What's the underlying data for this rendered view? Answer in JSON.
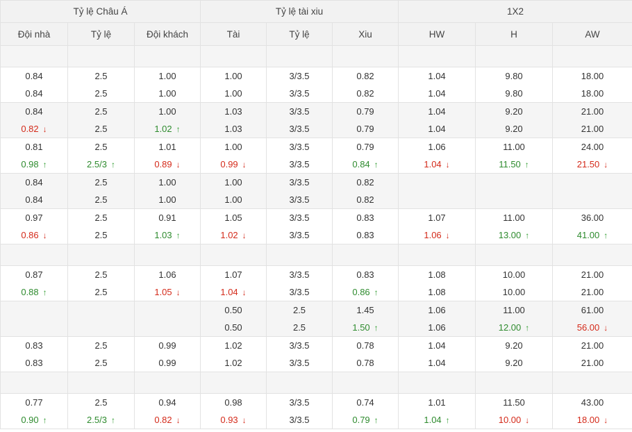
{
  "header": {
    "groups": [
      {
        "label": "Tỷ lệ Châu Á",
        "span": 3
      },
      {
        "label": "Tỷ lệ tài xiu",
        "span": 3
      },
      {
        "label": "1X2",
        "span": 3
      }
    ],
    "columns": [
      "Đội nhà",
      "Tỷ lệ",
      "Đội khách",
      "Tài",
      "Tỷ lệ",
      "Xiu",
      "HW",
      "H",
      "AW"
    ]
  },
  "rows": [
    {
      "empty": true,
      "shade": true
    },
    {
      "shade": false,
      "cells": [
        [
          {
            "v": "0.84"
          },
          {
            "v": "0.84"
          }
        ],
        [
          {
            "v": "2.5"
          },
          {
            "v": "2.5"
          }
        ],
        [
          {
            "v": "1.00"
          },
          {
            "v": "1.00"
          }
        ],
        [
          {
            "v": "1.00"
          },
          {
            "v": "1.00"
          }
        ],
        [
          {
            "v": "3/3.5"
          },
          {
            "v": "3/3.5"
          }
        ],
        [
          {
            "v": "0.82"
          },
          {
            "v": "0.82"
          }
        ],
        [
          {
            "v": "1.04"
          },
          {
            "v": "1.04"
          }
        ],
        [
          {
            "v": "9.80"
          },
          {
            "v": "9.80"
          }
        ],
        [
          {
            "v": "18.00"
          },
          {
            "v": "18.00"
          }
        ]
      ]
    },
    {
      "shade": true,
      "cells": [
        [
          {
            "v": "0.84"
          },
          {
            "v": "0.82",
            "t": "down"
          }
        ],
        [
          {
            "v": "2.5"
          },
          {
            "v": "2.5"
          }
        ],
        [
          {
            "v": "1.00"
          },
          {
            "v": "1.02",
            "t": "up"
          }
        ],
        [
          {
            "v": "1.03"
          },
          {
            "v": "1.03"
          }
        ],
        [
          {
            "v": "3/3.5"
          },
          {
            "v": "3/3.5"
          }
        ],
        [
          {
            "v": "0.79"
          },
          {
            "v": "0.79"
          }
        ],
        [
          {
            "v": "1.04"
          },
          {
            "v": "1.04"
          }
        ],
        [
          {
            "v": "9.20"
          },
          {
            "v": "9.20"
          }
        ],
        [
          {
            "v": "21.00"
          },
          {
            "v": "21.00"
          }
        ]
      ]
    },
    {
      "shade": false,
      "cells": [
        [
          {
            "v": "0.81"
          },
          {
            "v": "0.98",
            "t": "up"
          }
        ],
        [
          {
            "v": "2.5"
          },
          {
            "v": "2.5/3",
            "t": "up"
          }
        ],
        [
          {
            "v": "1.01"
          },
          {
            "v": "0.89",
            "t": "down"
          }
        ],
        [
          {
            "v": "1.00"
          },
          {
            "v": "0.99",
            "t": "down"
          }
        ],
        [
          {
            "v": "3/3.5"
          },
          {
            "v": "3/3.5"
          }
        ],
        [
          {
            "v": "0.79"
          },
          {
            "v": "0.84",
            "t": "up"
          }
        ],
        [
          {
            "v": "1.06"
          },
          {
            "v": "1.04",
            "t": "down"
          }
        ],
        [
          {
            "v": "11.00"
          },
          {
            "v": "11.50",
            "t": "up"
          }
        ],
        [
          {
            "v": "24.00"
          },
          {
            "v": "21.50",
            "t": "down"
          }
        ]
      ]
    },
    {
      "shade": true,
      "cells": [
        [
          {
            "v": "0.84"
          },
          {
            "v": "0.84"
          }
        ],
        [
          {
            "v": "2.5"
          },
          {
            "v": "2.5"
          }
        ],
        [
          {
            "v": "1.00"
          },
          {
            "v": "1.00"
          }
        ],
        [
          {
            "v": "1.00"
          },
          {
            "v": "1.00"
          }
        ],
        [
          {
            "v": "3/3.5"
          },
          {
            "v": "3/3.5"
          }
        ],
        [
          {
            "v": "0.82"
          },
          {
            "v": "0.82"
          }
        ],
        [],
        [],
        []
      ]
    },
    {
      "shade": false,
      "cells": [
        [
          {
            "v": "0.97"
          },
          {
            "v": "0.86",
            "t": "down"
          }
        ],
        [
          {
            "v": "2.5"
          },
          {
            "v": "2.5"
          }
        ],
        [
          {
            "v": "0.91"
          },
          {
            "v": "1.03",
            "t": "up"
          }
        ],
        [
          {
            "v": "1.05"
          },
          {
            "v": "1.02",
            "t": "down"
          }
        ],
        [
          {
            "v": "3/3.5"
          },
          {
            "v": "3/3.5"
          }
        ],
        [
          {
            "v": "0.83"
          },
          {
            "v": "0.83"
          }
        ],
        [
          {
            "v": "1.07"
          },
          {
            "v": "1.06",
            "t": "down"
          }
        ],
        [
          {
            "v": "11.00"
          },
          {
            "v": "13.00",
            "t": "up"
          }
        ],
        [
          {
            "v": "36.00"
          },
          {
            "v": "41.00",
            "t": "up"
          }
        ]
      ]
    },
    {
      "empty": true,
      "shade": true
    },
    {
      "shade": false,
      "cells": [
        [
          {
            "v": "0.87"
          },
          {
            "v": "0.88",
            "t": "up"
          }
        ],
        [
          {
            "v": "2.5"
          },
          {
            "v": "2.5"
          }
        ],
        [
          {
            "v": "1.06"
          },
          {
            "v": "1.05",
            "t": "down"
          }
        ],
        [
          {
            "v": "1.07"
          },
          {
            "v": "1.04",
            "t": "down"
          }
        ],
        [
          {
            "v": "3/3.5"
          },
          {
            "v": "3/3.5"
          }
        ],
        [
          {
            "v": "0.83"
          },
          {
            "v": "0.86",
            "t": "up"
          }
        ],
        [
          {
            "v": "1.08"
          },
          {
            "v": "1.08"
          }
        ],
        [
          {
            "v": "10.00"
          },
          {
            "v": "10.00"
          }
        ],
        [
          {
            "v": "21.00"
          },
          {
            "v": "21.00"
          }
        ]
      ]
    },
    {
      "shade": true,
      "cells": [
        [],
        [],
        [],
        [
          {
            "v": "0.50"
          },
          {
            "v": "0.50"
          }
        ],
        [
          {
            "v": "2.5"
          },
          {
            "v": "2.5"
          }
        ],
        [
          {
            "v": "1.45"
          },
          {
            "v": "1.50",
            "t": "up"
          }
        ],
        [
          {
            "v": "1.06"
          },
          {
            "v": "1.06"
          }
        ],
        [
          {
            "v": "11.00"
          },
          {
            "v": "12.00",
            "t": "up"
          }
        ],
        [
          {
            "v": "61.00"
          },
          {
            "v": "56.00",
            "t": "down"
          }
        ]
      ]
    },
    {
      "shade": false,
      "cells": [
        [
          {
            "v": "0.83"
          },
          {
            "v": "0.83"
          }
        ],
        [
          {
            "v": "2.5"
          },
          {
            "v": "2.5"
          }
        ],
        [
          {
            "v": "0.99"
          },
          {
            "v": "0.99"
          }
        ],
        [
          {
            "v": "1.02"
          },
          {
            "v": "1.02"
          }
        ],
        [
          {
            "v": "3/3.5"
          },
          {
            "v": "3/3.5"
          }
        ],
        [
          {
            "v": "0.78"
          },
          {
            "v": "0.78"
          }
        ],
        [
          {
            "v": "1.04"
          },
          {
            "v": "1.04"
          }
        ],
        [
          {
            "v": "9.20"
          },
          {
            "v": "9.20"
          }
        ],
        [
          {
            "v": "21.00"
          },
          {
            "v": "21.00"
          }
        ]
      ]
    },
    {
      "empty": true,
      "shade": true
    },
    {
      "shade": false,
      "cells": [
        [
          {
            "v": "0.77"
          },
          {
            "v": "0.90",
            "t": "up"
          }
        ],
        [
          {
            "v": "2.5"
          },
          {
            "v": "2.5/3",
            "t": "up"
          }
        ],
        [
          {
            "v": "0.94"
          },
          {
            "v": "0.82",
            "t": "down"
          }
        ],
        [
          {
            "v": "0.98"
          },
          {
            "v": "0.93",
            "t": "down"
          }
        ],
        [
          {
            "v": "3/3.5"
          },
          {
            "v": "3/3.5"
          }
        ],
        [
          {
            "v": "0.74"
          },
          {
            "v": "0.79",
            "t": "up"
          }
        ],
        [
          {
            "v": "1.01"
          },
          {
            "v": "1.04",
            "t": "up"
          }
        ],
        [
          {
            "v": "11.50"
          },
          {
            "v": "10.00",
            "t": "down"
          }
        ],
        [
          {
            "v": "43.00"
          },
          {
            "v": "18.00",
            "t": "down"
          }
        ]
      ]
    }
  ],
  "icons": {
    "up": "arrow-up-icon",
    "down": "arrow-down-icon"
  },
  "colors": {
    "up": "#2e8b2e",
    "down": "#d42a1a",
    "header_bg": "#f2f2f2",
    "shade_bg": "#f5f5f5"
  }
}
